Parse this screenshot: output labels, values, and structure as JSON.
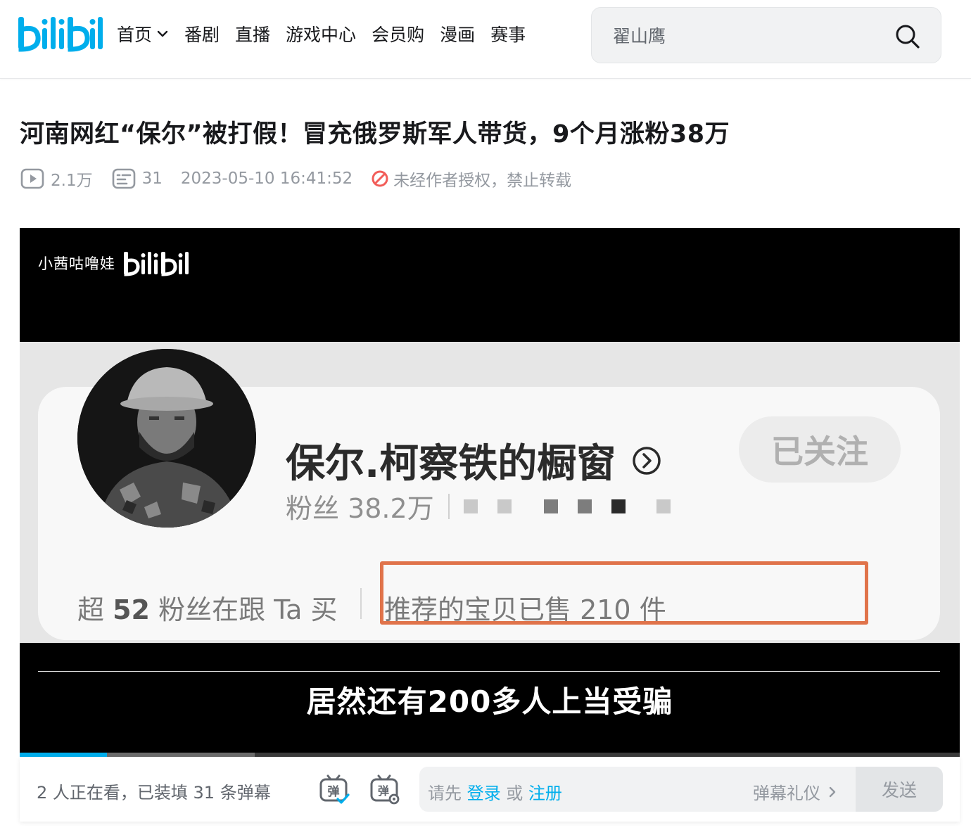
{
  "brand": {
    "logo_text": "bilibili",
    "accent": "#00aeec"
  },
  "nav": {
    "items": [
      {
        "label": "首页",
        "has_dropdown": true
      },
      {
        "label": "番剧"
      },
      {
        "label": "直播"
      },
      {
        "label": "游戏中心"
      },
      {
        "label": "会员购"
      },
      {
        "label": "漫画"
      },
      {
        "label": "赛事"
      }
    ]
  },
  "search": {
    "placeholder": "翟山鹰",
    "icon": "search-icon"
  },
  "video": {
    "title": "河南网红“保尔”被打假！冒充俄罗斯军人带货，9个月涨粉38万",
    "views": "2.1万",
    "danmaku_count": "31",
    "publish_time": "2023-05-10 16:41:52",
    "copyright": "未经作者授权，禁止转载"
  },
  "frame": {
    "watermark_text": "小茜咕噜娃",
    "watermark_logo": "bilibili",
    "shop_name": "保尔.柯察铁的橱窗",
    "follow_label": "已关注",
    "fans": "粉丝 38.2万",
    "follow_buy_prefix": "超",
    "follow_buy_number": "52",
    "follow_buy_suffix": "粉丝在跟 Ta 买",
    "sold_text": "推荐的宝贝已售 210 件",
    "subtitle": "居然还有200多人上当受骗",
    "highlight_color": "#e0734a"
  },
  "player": {
    "played_fraction": 0.093,
    "buffered_fraction": 0.25
  },
  "danmaku_bar": {
    "viewers_text": "2 人正在看，已装填 31 条弹幕",
    "prompt_prefix": "请先",
    "login_label": "登录",
    "or_label": "或",
    "register_label": "注册",
    "etiquette_label": "弹幕礼仪",
    "send_label": "发送"
  }
}
